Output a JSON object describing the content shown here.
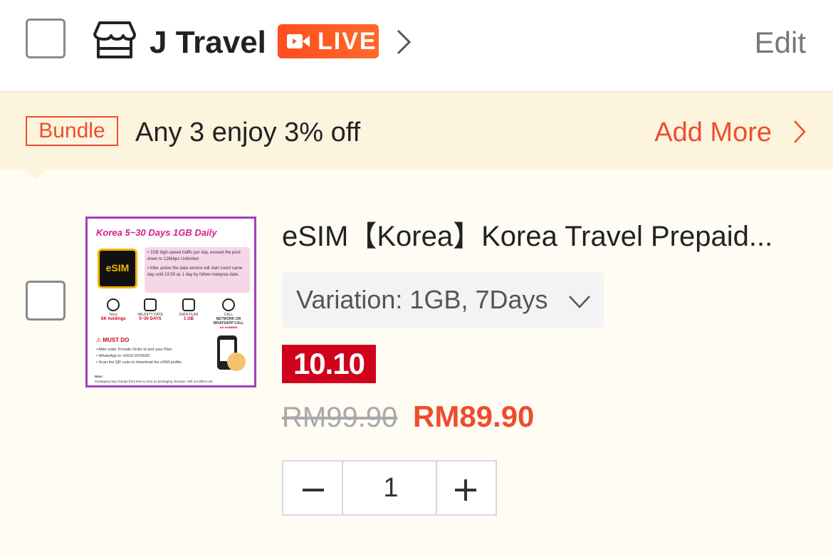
{
  "header": {
    "shop_name": "J Travel",
    "live_label": "LIVE",
    "edit_label": "Edit"
  },
  "bundle": {
    "tag": "Bundle",
    "text": "Any 3 enjoy 3% off",
    "add_more": "Add More"
  },
  "product": {
    "title": "eSIM【Korea】Korea Travel Prepaid...",
    "variation": "Variation: 1GB, 7Days",
    "promo_badge": "10.10",
    "price_original": "RM99.90",
    "price_current": "RM89.90",
    "quantity": "1",
    "image": {
      "title": "Korea 5~30 Days 1GB Daily",
      "chip_label": "eSIM",
      "info_line1": "• 1GB high-speed traffic per day, exceed the post-down to 128kbps Unlimited",
      "info_line2": "• After active the data service will start count same day until 23:59 as 1 day by follow malaysia date.",
      "telco_label": "Telco",
      "telco_brand": "SK holdings",
      "validity_label": "VALIDITY DATE",
      "validity_value": "5~30 DAYS",
      "dataplan_label": "DATA PLAN",
      "dataplan_value": "1 GB",
      "call_label": "CALL",
      "call_value": "NETWORK OR WHATSAPP CALL",
      "call_note": "NO NUMBER",
      "must_do": "MUST DO",
      "must_items": [
        "• After order Provide Order id and your Plan.",
        "• WhatsApp to +6010-2076600",
        "• Scan the QR code to download the eSIM profile."
      ],
      "note_title": "Note :",
      "note_text": "Packaging may change from time to time as packaging changes. Will not affect use."
    }
  },
  "colors": {
    "accent": "#ee4d2d",
    "promo": "#d0011b",
    "bundle_bg": "#fdf4de",
    "page_bg": "#fffcf4"
  },
  "icons": {
    "shop": "shop-icon",
    "live_camera": "video-camera-icon",
    "chevron_right": "chevron-right-icon",
    "chevron_down": "chevron-down-icon",
    "minus": "minus-icon",
    "plus": "plus-icon"
  }
}
